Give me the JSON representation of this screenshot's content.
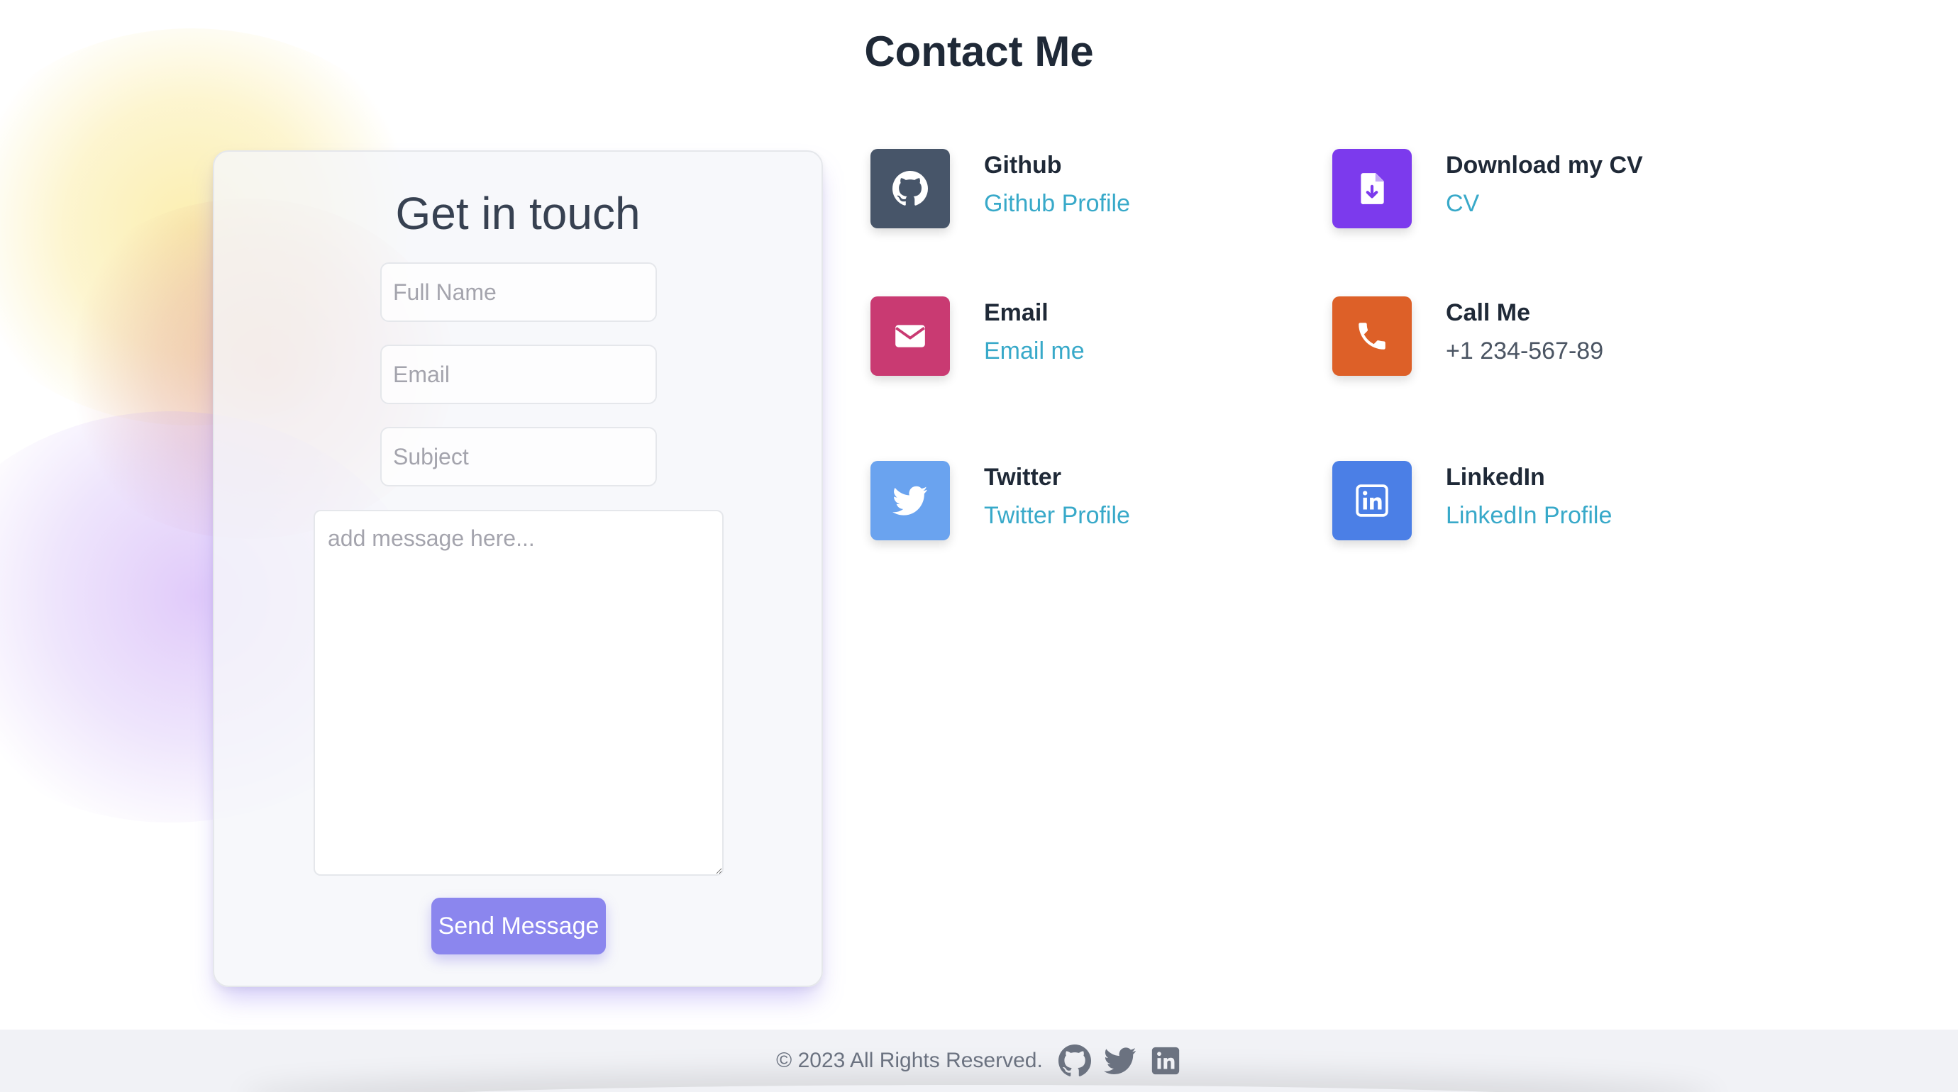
{
  "page": {
    "title": "Contact Me"
  },
  "form": {
    "heading": "Get in touch",
    "full_name_placeholder": "Full Name",
    "email_placeholder": "Email",
    "subject_placeholder": "Subject",
    "message_placeholder": "add message here...",
    "send_label": "Send Message"
  },
  "contacts": [
    {
      "title": "Github",
      "link": "Github Profile",
      "icon": "github-icon",
      "color": "#475569"
    },
    {
      "title": "Download my CV",
      "link": "CV",
      "icon": "file-download-icon",
      "color": "#7c3aed"
    },
    {
      "title": "Email",
      "link": "Email me",
      "icon": "envelope-icon",
      "color": "#c93a72"
    },
    {
      "title": "Call Me",
      "text": "+1 234-567-89",
      "icon": "phone-icon",
      "color": "#dd6028"
    },
    {
      "title": "Twitter",
      "link": "Twitter Profile",
      "icon": "twitter-icon",
      "color": "#6aa3ef"
    },
    {
      "title": "LinkedIn",
      "link": "LinkedIn Profile",
      "icon": "linkedin-icon",
      "color": "#4b7fe6"
    }
  ],
  "colors": {
    "link": "#38a9c9",
    "button": "#8b86ee",
    "footer_bg": "#f1f2f6",
    "footer_icon": "#6b7280"
  },
  "footer": {
    "copyright": "© 2023 All Rights Reserved.",
    "icons": [
      "github-icon",
      "twitter-icon",
      "linkedin-icon"
    ]
  }
}
